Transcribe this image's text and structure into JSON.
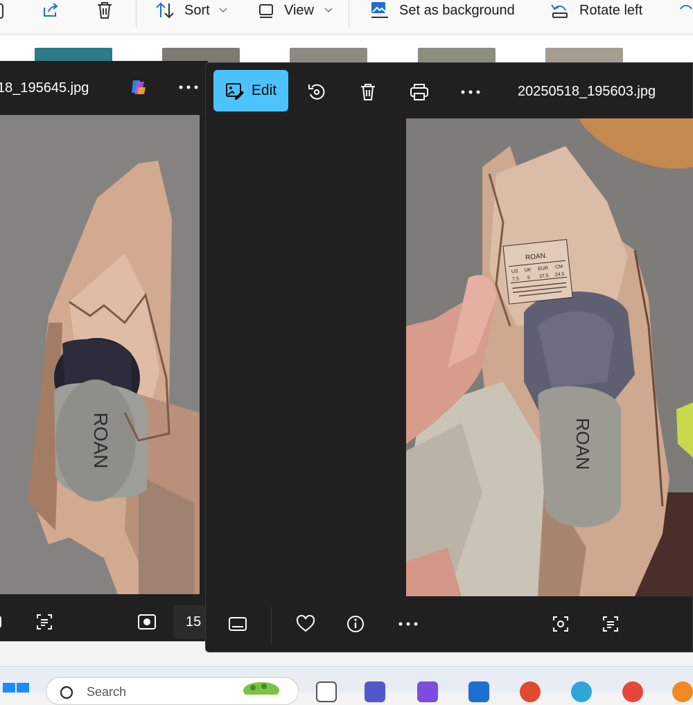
{
  "explorer": {
    "toolbar": {
      "sort_label": "Sort",
      "view_label": "View",
      "set_background_label": "Set as background",
      "rotate_left_label": "Rotate left"
    }
  },
  "photos_left": {
    "filename": "18_195645.jpg",
    "zoom_value": "15"
  },
  "photos_right": {
    "edit_label": "Edit",
    "filename": "20250518_195603.jpg"
  },
  "label_text": {
    "brand": "ROAN.",
    "sizes": [
      "US",
      "UK",
      "EUR",
      "CM"
    ],
    "values": [
      "7.5",
      "5",
      "37.5",
      "24.5"
    ]
  },
  "insole_text": "ROAN",
  "taskbar": {
    "search_placeholder": "Search"
  },
  "colors": {
    "accent": "#4cc2ff",
    "photos_bg": "#202020",
    "taskbar": "#e8edf3"
  }
}
